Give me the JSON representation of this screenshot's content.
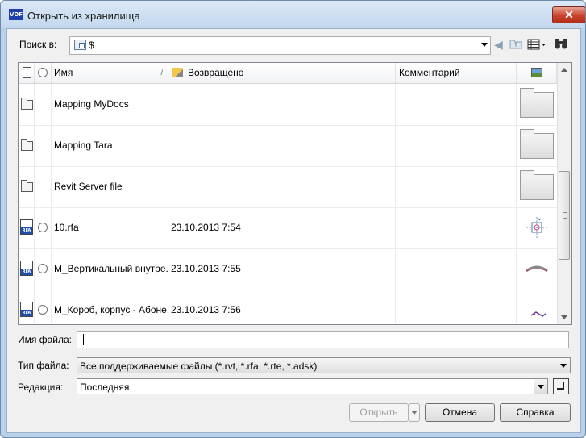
{
  "window": {
    "title": "Открыть из хранилища",
    "app_icon_text": "VDF",
    "close_glyph": "✕"
  },
  "lookin": {
    "label": "Поиск в:",
    "value": "$"
  },
  "columns": {
    "name": "Имя",
    "returned": "Возвращено",
    "comment": "Комментарий"
  },
  "files": [
    {
      "name": "Mapping MyDocs",
      "date": "",
      "kind": "folder"
    },
    {
      "name": "Mapping Tara",
      "date": "",
      "kind": "folder"
    },
    {
      "name": "Revit Server file",
      "date": "",
      "kind": "folder"
    },
    {
      "name": "10.rfa",
      "date": "23.10.2013 7:54",
      "kind": "rfa"
    },
    {
      "name": "M_Вертикальный внутре...",
      "date": "23.10.2013 7:55",
      "kind": "rfa"
    },
    {
      "name": "M_Короб, корпус - Абоне...",
      "date": "23.10.2013 7:56",
      "kind": "rfa"
    }
  ],
  "rfa_label": "RFA",
  "form": {
    "filename_label": "Имя файла:",
    "filename_value": "",
    "filetype_label": "Тип файла:",
    "filetype_value": "Все поддерживаемые файлы (*.rvt, *.rfa, *.rte, *.adsk)",
    "revision_label": "Редакция:",
    "revision_value": "Последняя"
  },
  "buttons": {
    "open": "Открыть",
    "cancel": "Отмена",
    "help": "Справка"
  },
  "toolbar_icons": [
    "back-arrow-icon",
    "folder-up-icon",
    "view-menu-icon",
    "binoculars-icon"
  ],
  "colors": {
    "title_bar": "#c3d7ee",
    "close_button": "#c8422d",
    "rfa_badge": "#1f4fae"
  }
}
